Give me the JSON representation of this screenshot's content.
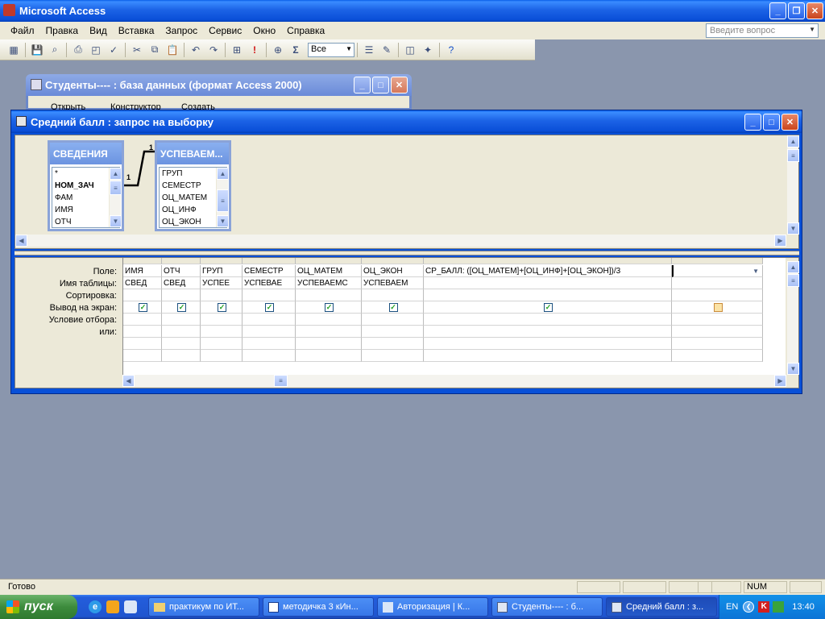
{
  "app": {
    "title": "Microsoft Access"
  },
  "menu": [
    "Файл",
    "Правка",
    "Вид",
    "Вставка",
    "Запрос",
    "Сервис",
    "Окно",
    "Справка"
  ],
  "help_placeholder": "Введите вопрос",
  "toolbar": {
    "top_values": "Все"
  },
  "db_window": {
    "title": "Студенты---- : база данных (формат Access 2000)",
    "toolbar": {
      "open": "Открыть",
      "design": "Конструктор",
      "create": "Создать"
    }
  },
  "query_window": {
    "title": "Средний балл : запрос на выборку",
    "tables": [
      {
        "name": "СВЕДЕНИЯ",
        "fields": [
          "*",
          "НОМ_ЗАЧ",
          "ФАМ",
          "ИМЯ",
          "ОТЧ"
        ]
      },
      {
        "name": "УСПЕВАЕМ...",
        "fields": [
          "ГРУП",
          "СЕМЕСТР",
          "ОЦ_МАТЕМ",
          "ОЦ_ИНФ",
          "ОЦ_ЭКОН"
        ]
      }
    ],
    "relation": {
      "left_label": "1",
      "right_label": "1"
    },
    "row_labels": [
      "Поле:",
      "Имя таблицы:",
      "Сортировка:",
      "Вывод на экран:",
      "Условие отбора:",
      "или:"
    ],
    "columns": [
      {
        "field": "ИМЯ",
        "table": "СВЕД",
        "show": true
      },
      {
        "field": "ОТЧ",
        "table": "СВЕД",
        "show": true
      },
      {
        "field": "ГРУП",
        "table": "УСПЕЕ",
        "show": true
      },
      {
        "field": "СЕМЕСТР",
        "table": "УСПЕВАЕ",
        "show": true
      },
      {
        "field": "ОЦ_МАТЕМ",
        "table": "УСПЕВАЕМС",
        "show": true
      },
      {
        "field": "ОЦ_ЭКОН",
        "table": "УСПЕВАЕМ",
        "show": true
      },
      {
        "field": "СР_БАЛЛ: ([ОЦ_МАТЕМ]+[ОЦ_ИНФ]+[ОЦ_ЭКОН])/3",
        "table": "",
        "show": true
      },
      {
        "field": "",
        "table": "",
        "show": false
      }
    ]
  },
  "status": {
    "left": "Готово",
    "num": "NUM"
  },
  "taskbar": {
    "start": "пуск",
    "tasks": [
      "практикум по ИТ...",
      "методичка 3 кИн...",
      "Авторизация | К...",
      "Студенты---- : б...",
      "Средний балл : з..."
    ],
    "lang": "EN",
    "clock": "13:40"
  }
}
